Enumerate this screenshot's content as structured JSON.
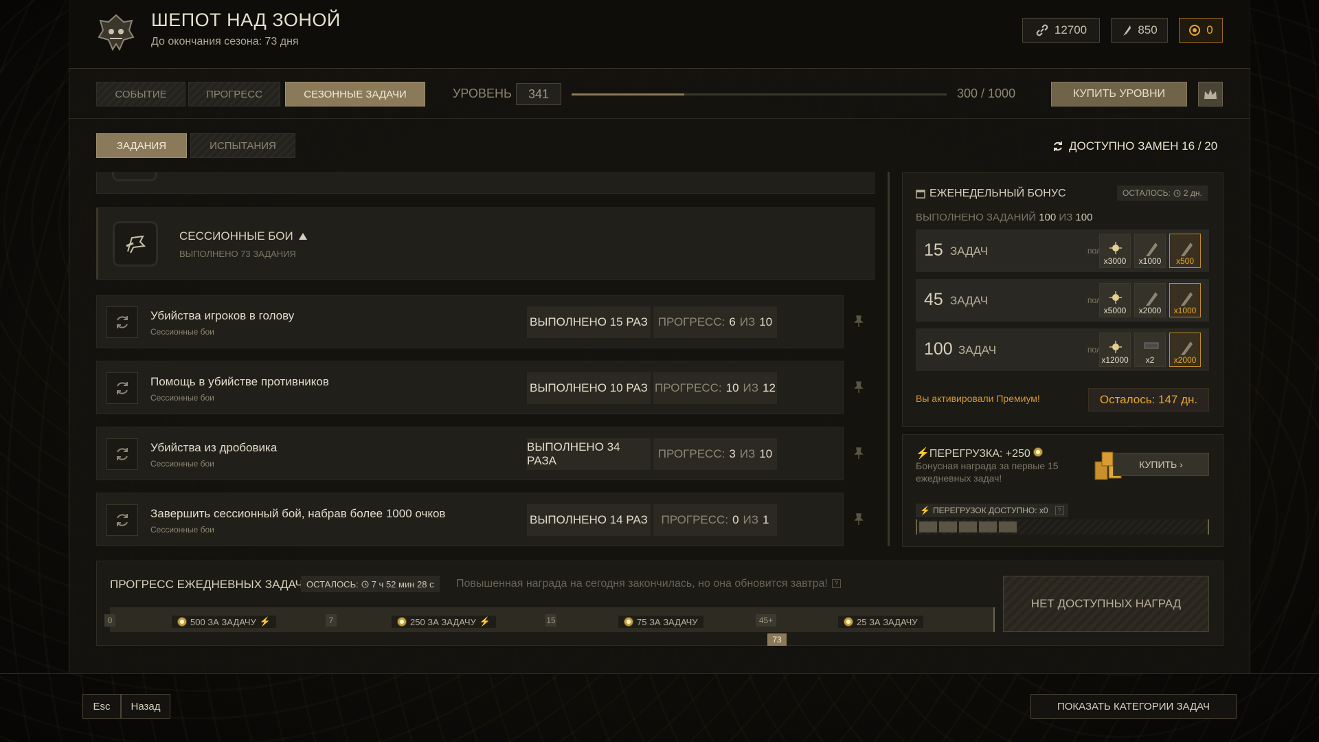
{
  "header": {
    "title": "ШЕПОТ НАД ЗОНОЙ",
    "subtitle": "До окончания сезона: 73 дня",
    "currencies": [
      {
        "icon": "chain-icon",
        "value": "12700"
      },
      {
        "icon": "feather-icon",
        "value": "850"
      },
      {
        "icon": "gold-coin-icon",
        "value": "0"
      }
    ]
  },
  "tabs": {
    "event": "СОБЫТИЕ",
    "progress": "ПРОГРЕСС",
    "season_tasks": "СЕЗОННЫЕ ЗАДАЧИ"
  },
  "level": {
    "label": "УРОВЕНЬ",
    "value": "341",
    "progress_text": "300 / 1000",
    "progress_fraction": 0.3
  },
  "buy_levels": "КУПИТЬ УРОВНИ",
  "subtabs": {
    "tasks": "ЗАДАНИЯ",
    "trials": "ИСПЫТАНИЯ"
  },
  "replacements": "ДОСТУПНО ЗАМЕН 16 / 20",
  "category": {
    "name": "СЕССИОННЫЕ БОИ",
    "sub": "ВЫПОЛНЕНО 73 ЗАДАНИЯ"
  },
  "progress_label": "ПРОГРЕСС:",
  "of_label": "ИЗ",
  "tasks": [
    {
      "name": "Убийства игроков в голову",
      "category": "Сессионные бои",
      "done": "ВЫПОЛНЕНО 15 РАЗ",
      "cur": "6",
      "max": "10"
    },
    {
      "name": "Помощь в убийстве противников",
      "category": "Сессионные бои",
      "done": "ВЫПОЛНЕНО 10 РАЗ",
      "cur": "10",
      "max": "12"
    },
    {
      "name": "Убийства из дробовика",
      "category": "Сессионные бои",
      "done": "ВЫПОЛНЕНО 34 РАЗА",
      "cur": "3",
      "max": "10"
    },
    {
      "name": "Завершить сессионный бой, набрав более 1000 очков",
      "category": "Сессионные бои",
      "done": "ВЫПОЛНЕНО 14 РАЗ",
      "cur": "0",
      "max": "1"
    }
  ],
  "weekly": {
    "title": "ЕЖЕНЕДЕЛЬНЫЙ БОНУС",
    "remain": "ОСТАЛОСЬ:",
    "remain_val": "2 дн.",
    "done_label": "ВЫПОЛНЕНО ЗАДАНИЙ",
    "done": "100",
    "of": "ИЗ",
    "total": "100",
    "tasks_word": "ЗАДАЧ",
    "received": "получено",
    "tiers": [
      {
        "n": "15",
        "rewards": [
          "x3000",
          "x1000",
          "x500"
        ]
      },
      {
        "n": "45",
        "rewards": [
          "x5000",
          "x2000",
          "x1000"
        ]
      },
      {
        "n": "100",
        "rewards": [
          "x12000",
          "x2",
          "x2000"
        ]
      }
    ],
    "premium": "Вы активировали Премиум!",
    "premium_left": "Осталось: 147 дн."
  },
  "overload": {
    "title": "ПЕРЕГРУЗКА: +250",
    "desc": "Бонусная награда за первые 15 ежедневных задач!",
    "buy": "КУПИТЬ",
    "available": "ПЕРЕГРУЗОК ДОСТУПНО: x0",
    "filled_segments": 5,
    "total_segments": 13
  },
  "daily": {
    "title": "ПРОГРЕСС ЕЖЕДНЕВНЫХ ЗАДАЧ",
    "remain": "ОСТАЛОСЬ:",
    "remain_val": "7 ч 52 мин 28 с",
    "note": "Повышенная награда на сегодня закончилась, но она обновится завтра!",
    "markers": [
      "0",
      "7",
      "15",
      "45+"
    ],
    "current": "73",
    "segments": [
      "500 ЗА ЗАДАЧУ",
      "250 ЗА ЗАДАЧУ",
      "75 ЗА ЗАДАЧУ",
      "25 ЗА ЗАДАЧУ"
    ],
    "no_rewards": "НЕТ ДОСТУПНЫХ НАГРАД"
  },
  "footer": {
    "esc": "Esc",
    "back": "Назад",
    "show_categories": "ПОКАЗАТЬ КАТЕГОРИИ ЗАДАЧ"
  },
  "colors": {
    "accent": "#8a7a5a",
    "gold": "#e6a830",
    "panel": "#211f19"
  }
}
